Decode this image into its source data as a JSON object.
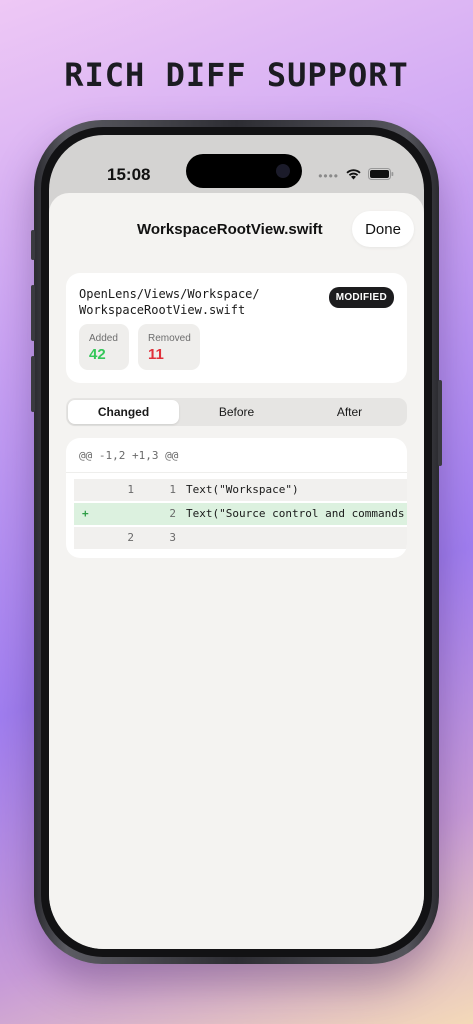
{
  "headline": "RICH DIFF SUPPORT",
  "status_bar": {
    "time": "15:08",
    "dots": "••••"
  },
  "nav": {
    "title": "WorkspaceRootView.swift",
    "done_label": "Done"
  },
  "file": {
    "path_line1": "OpenLens/Views/Workspace/",
    "path_line2": "WorkspaceRootView.swift",
    "badge": "MODIFIED",
    "added_label": "Added",
    "added_value": "42",
    "removed_label": "Removed",
    "removed_value": "11"
  },
  "segments": [
    {
      "label": "Changed",
      "active": true
    },
    {
      "label": "Before",
      "active": false
    },
    {
      "label": "After",
      "active": false
    }
  ],
  "diff": {
    "hunk_header": "@@ -1,2 +1,3 @@",
    "rows": [
      {
        "marker": "",
        "old": "1",
        "new": "1",
        "code": "Text(\"Workspace\")",
        "type": "context"
      },
      {
        "marker": "+",
        "old": "",
        "new": "2",
        "code": "Text(\"Source control and commands i",
        "type": "added"
      },
      {
        "marker": "",
        "old": "2",
        "new": "3",
        "code": "",
        "type": "context"
      }
    ]
  },
  "colors": {
    "added": "#34c759",
    "removed": "#e0303a",
    "badge_bg": "#1c1c1e",
    "added_row_bg": "#dcf1df"
  }
}
